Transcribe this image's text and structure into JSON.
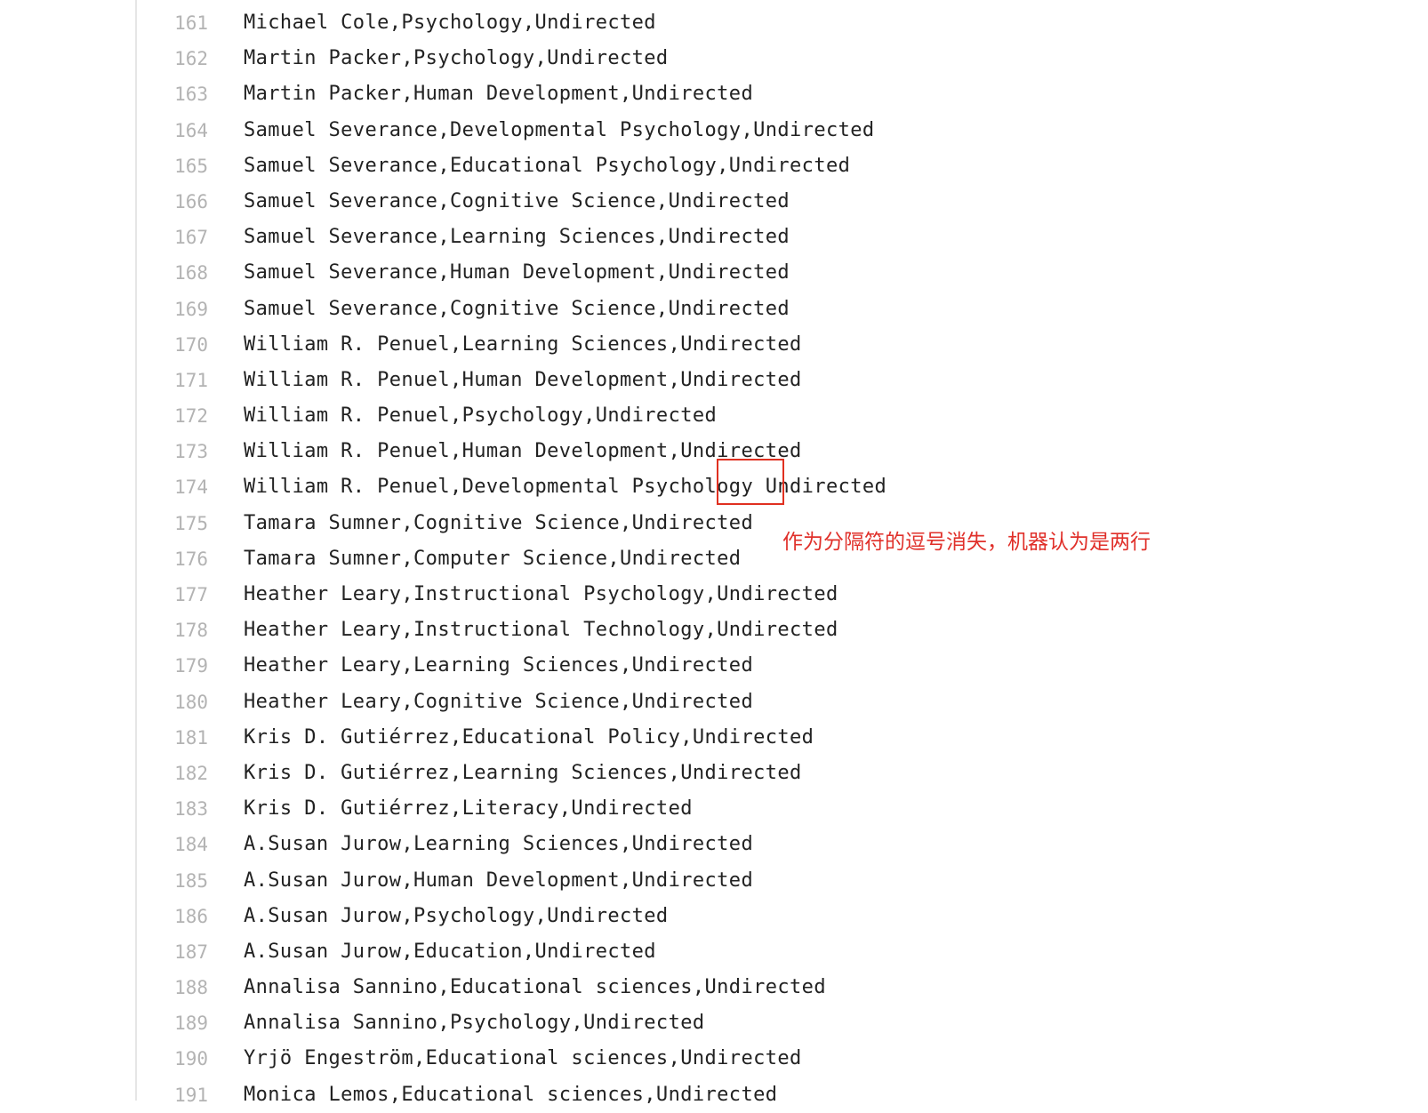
{
  "code": {
    "lines": [
      {
        "num": "161",
        "text": "Michael Cole,Psychology,Undirected"
      },
      {
        "num": "162",
        "text": "Martin Packer,Psychology,Undirected"
      },
      {
        "num": "163",
        "text": "Martin Packer,Human Development,Undirected"
      },
      {
        "num": "164",
        "text": "Samuel Severance,Developmental Psychology,Undirected"
      },
      {
        "num": "165",
        "text": "Samuel Severance,Educational Psychology,Undirected"
      },
      {
        "num": "166",
        "text": "Samuel Severance,Cognitive Science,Undirected"
      },
      {
        "num": "167",
        "text": "Samuel Severance,Learning Sciences,Undirected"
      },
      {
        "num": "168",
        "text": "Samuel Severance,Human Development,Undirected"
      },
      {
        "num": "169",
        "text": "Samuel Severance,Cognitive Science,Undirected"
      },
      {
        "num": "170",
        "text": "William R. Penuel,Learning Sciences,Undirected"
      },
      {
        "num": "171",
        "text": "William R. Penuel,Human Development,Undirected"
      },
      {
        "num": "172",
        "text": "William R. Penuel,Psychology,Undirected"
      },
      {
        "num": "173",
        "text": "William R. Penuel,Human Development,Undirected"
      },
      {
        "num": "174",
        "text": "William R. Penuel,Developmental Psychology Undirected"
      },
      {
        "num": "175",
        "text": "Tamara Sumner,Cognitive Science,Undirected"
      },
      {
        "num": "176",
        "text": "Tamara Sumner,Computer Science,Undirected"
      },
      {
        "num": "177",
        "text": "Heather Leary,Instructional Psychology,Undirected"
      },
      {
        "num": "178",
        "text": "Heather Leary,Instructional Technology,Undirected"
      },
      {
        "num": "179",
        "text": "Heather Leary,Learning Sciences,Undirected"
      },
      {
        "num": "180",
        "text": "Heather Leary,Cognitive Science,Undirected"
      },
      {
        "num": "181",
        "text": "Kris D. Gutiérrez,Educational Policy,Undirected"
      },
      {
        "num": "182",
        "text": "Kris D. Gutiérrez,Learning Sciences,Undirected"
      },
      {
        "num": "183",
        "text": "Kris D. Gutiérrez,Literacy,Undirected"
      },
      {
        "num": "184",
        "text": "A.Susan Jurow,Learning Sciences,Undirected"
      },
      {
        "num": "185",
        "text": "A.Susan Jurow,Human Development,Undirected"
      },
      {
        "num": "186",
        "text": "A.Susan Jurow,Psychology,Undirected"
      },
      {
        "num": "187",
        "text": "A.Susan Jurow,Education,Undirected"
      },
      {
        "num": "188",
        "text": "Annalisa Sannino,Educational sciences,Undirected"
      },
      {
        "num": "189",
        "text": "Annalisa Sannino,Psychology,Undirected"
      },
      {
        "num": "190",
        "text": "Yrjö Engeström,Educational sciences,Undirected"
      },
      {
        "num": "191",
        "text": "Monica Lemos,Educational sciences,Undirected"
      }
    ]
  },
  "annotation": {
    "text": "作为分隔符的逗号消失，机器认为是两行",
    "color": "#e0302a"
  },
  "colors": {
    "line_number": "#b3b3b3",
    "text": "#222222",
    "gutter_border": "#e6e6e6",
    "highlight_box": "#e03020"
  }
}
